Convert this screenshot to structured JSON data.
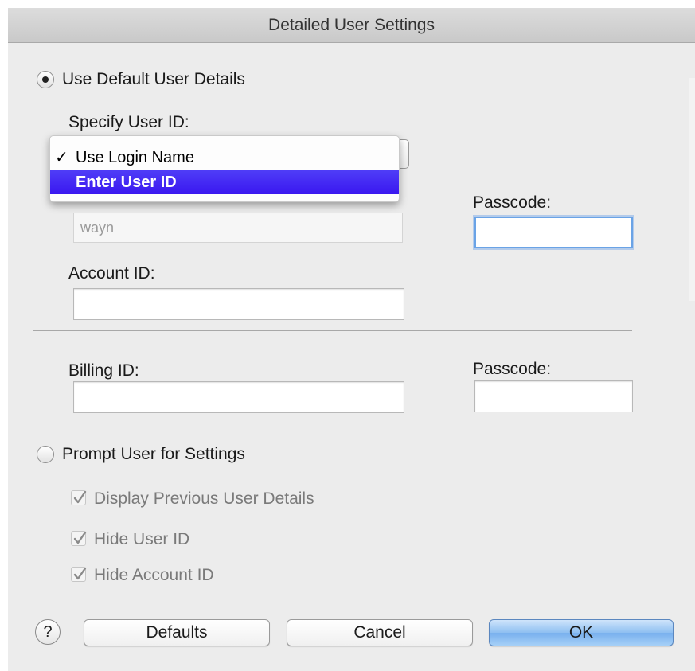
{
  "window": {
    "title": "Detailed User Settings"
  },
  "default_details": {
    "label": "Use Default User Details",
    "selected": true
  },
  "user_id": {
    "label": "Specify User ID:",
    "menu": {
      "items": [
        {
          "label": "Use Login Name",
          "checked": true
        },
        {
          "label": "Enter User ID",
          "highlighted": true
        }
      ]
    },
    "value": "wayn"
  },
  "passcode1": {
    "label": "Passcode:",
    "value": ""
  },
  "account_id": {
    "label": "Account ID:",
    "value": ""
  },
  "billing_id": {
    "label": "Billing ID:",
    "value": ""
  },
  "passcode2": {
    "label": "Passcode:",
    "value": ""
  },
  "prompt": {
    "label": "Prompt User for Settings",
    "selected": false,
    "options": [
      {
        "label": "Display Previous User Details",
        "checked": true
      },
      {
        "label": "Hide User ID",
        "checked": true
      },
      {
        "label": "Hide Account ID",
        "checked": true
      }
    ]
  },
  "footer": {
    "help": "?",
    "defaults": "Defaults",
    "cancel": "Cancel",
    "ok": "OK"
  }
}
